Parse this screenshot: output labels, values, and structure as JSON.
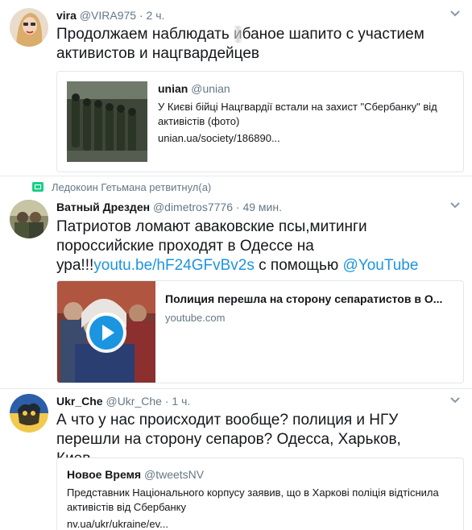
{
  "tweets": [
    {
      "name": "vira",
      "handle": "@VIRA975",
      "separator": "·",
      "time": "2 ч.",
      "text": "Продолжаем наблюдать ",
      "text_obscured": "и",
      "text_rest": "баное шапито с участием активистов и нацгвардейцев",
      "card": {
        "title": "unian",
        "handle": "@unian",
        "description": "У Києві бійці Нацгвардії встали на захист \"Сбербанку\" від активістів (фото)",
        "domain": "unian.ua/society/186890..."
      }
    },
    {
      "retweet_context": "Ледокоин Гетьмана ретвитнул(а)",
      "name": "Ватный Дрезден",
      "handle": "@dimetros7776",
      "separator": "·",
      "time": "49 мин.",
      "text": "Патриотов ломают аваковские псы,митинги пороссийские проходят в Одессе на ура!!!",
      "link": "youtu.be/hF24GFvBv2s",
      "text_mid": " с помощью ",
      "mention": "@YouTube",
      "card": {
        "title": "Полиция перешла на сторону сепаратистов в О...",
        "domain": "youtube.com"
      }
    },
    {
      "name": "Ukr_Che",
      "handle": "@Ukr_Che",
      "separator": "·",
      "time": "1 ч.",
      "text": "А что у нас происходит вообще? полиция и НГУ перешли на сторону сепаров? Одесса, Харьков, Киев...",
      "card": {
        "title": "Новое Время",
        "handle": "@tweetsNV",
        "description": "Представник Національного корпусу заявив, що в Харкові поліція відтіснила активістів від Сбербанку",
        "domain": "nv.ua/ukr/ukraine/ev..."
      }
    }
  ],
  "colors": {
    "link": "#1b95e0",
    "secondary_text": "#657786",
    "border": "#e1e8ed",
    "retweet_green": "#19cf86",
    "play_button": "#1b95e0"
  },
  "icons": [
    "chevron-down-icon",
    "retweet-icon",
    "play-icon"
  ]
}
